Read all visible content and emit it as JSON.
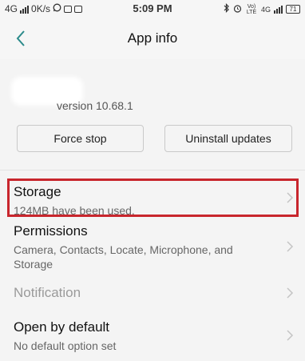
{
  "status_bar": {
    "network": "4G",
    "speed": "0K/s",
    "time": "5:09 PM",
    "volte": "Vo) LTE",
    "network2": "4G",
    "battery": "71"
  },
  "header": {
    "title": "App info"
  },
  "app": {
    "version": "version 10.68.1"
  },
  "buttons": {
    "force_stop": "Force stop",
    "uninstall_updates": "Uninstall updates"
  },
  "list": {
    "storage": {
      "title": "Storage",
      "subtitle": "124MB have been used."
    },
    "permissions": {
      "title": "Permissions",
      "subtitle": "Camera, Contacts, Locate, Microphone, and Storage"
    },
    "notification": {
      "title": "Notification"
    },
    "open_by_default": {
      "title": "Open by default",
      "subtitle": "No default option set"
    }
  },
  "colors": {
    "accent": "#2a8a8a",
    "highlight": "#c8262d"
  },
  "icons": [
    "back-arrow-icon",
    "chevron-right-icon",
    "signal-icon",
    "whatsapp-icon",
    "mail-icon",
    "gallery-icon",
    "bluetooth-icon",
    "alarm-icon",
    "battery-icon"
  ]
}
